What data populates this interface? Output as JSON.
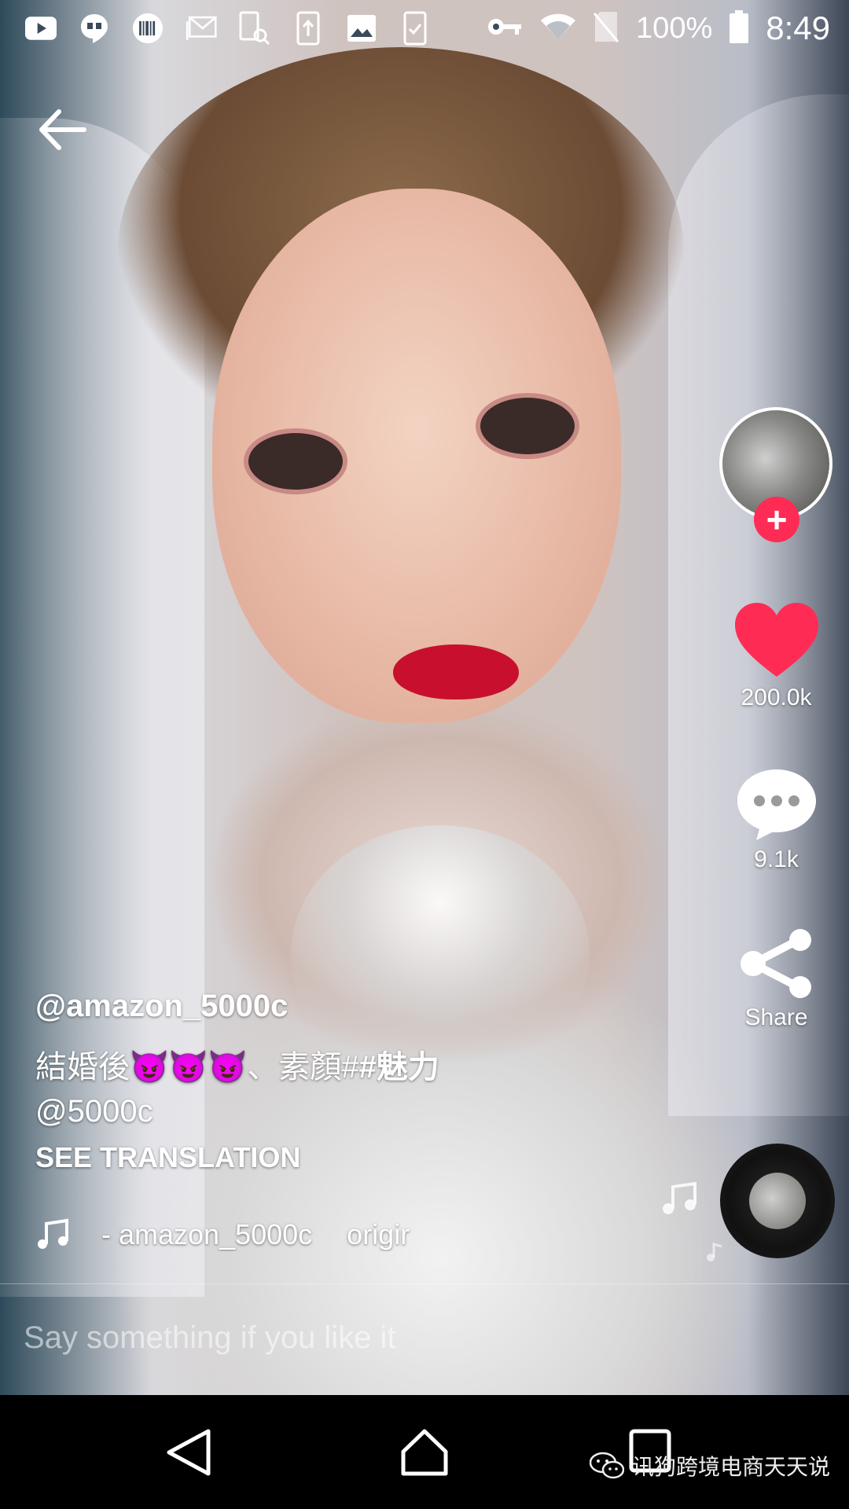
{
  "status_bar": {
    "battery_percent": "100%",
    "time": "8:49",
    "left_icons": [
      "youtube-icon",
      "hangouts-icon",
      "barcode-icon",
      "gmail-icon",
      "sim-search-icon",
      "upload-icon",
      "image-icon",
      "clipboard-check-icon"
    ],
    "right_icons": [
      "key-icon",
      "wifi-icon",
      "no-sim-icon",
      "battery-icon"
    ]
  },
  "video": {
    "author_handle": "@amazon_5000c",
    "caption": {
      "text_before": "結婚後",
      "emojis": "😈😈😈",
      "text_after": "、素顏#",
      "hashtag": "#魅力",
      "mention": "@5000c"
    },
    "see_translation": "SEE TRANSLATION",
    "music": {
      "author": "- amazon_5000c",
      "title": "origir"
    }
  },
  "actions": {
    "likes": "200.0k",
    "comments": "9.1k",
    "share_label": "Share"
  },
  "comment_box": {
    "placeholder": "Say something if you like it"
  },
  "watermark": {
    "text": "讯狗跨境电商天天说"
  },
  "colors": {
    "like_red": "#fe2c55",
    "follow_red": "#fe2c55"
  }
}
